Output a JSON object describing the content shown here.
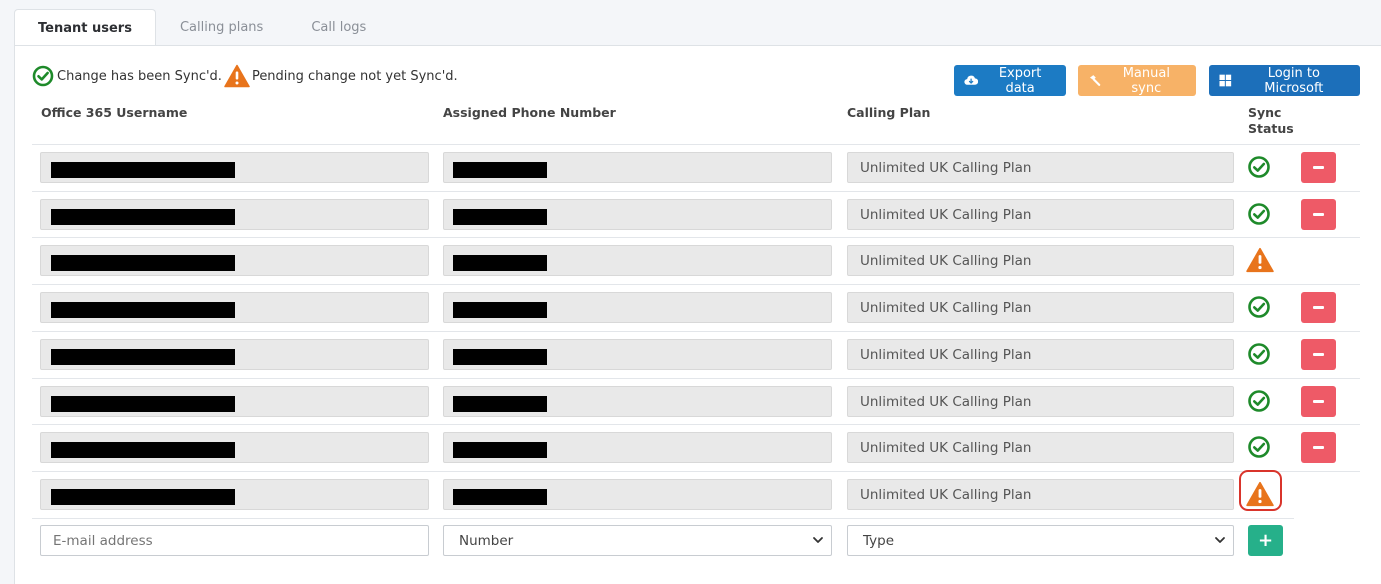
{
  "tabs": [
    {
      "label": "Tenant users",
      "active": true
    },
    {
      "label": "Calling plans",
      "active": false
    },
    {
      "label": "Call logs",
      "active": false
    }
  ],
  "legend": {
    "synced_text": "Change has been Sync'd.",
    "pending_text": "Pending change not yet Sync'd."
  },
  "toolbar": {
    "export_label": "Export data",
    "sync_label": "Manual sync",
    "login_label": "Login to Microsoft"
  },
  "columns": {
    "username": "Office 365 Username",
    "phone": "Assigned Phone Number",
    "plan": "Calling Plan",
    "status_line1": "Sync",
    "status_line2": "Status"
  },
  "rows": [
    {
      "plan": "Unlimited UK Calling Plan",
      "status": "synced",
      "deletable": true
    },
    {
      "plan": "Unlimited UK Calling Plan",
      "status": "synced",
      "deletable": true
    },
    {
      "plan": "Unlimited UK Calling Plan",
      "status": "pending",
      "deletable": false
    },
    {
      "plan": "Unlimited UK Calling Plan",
      "status": "synced",
      "deletable": true
    },
    {
      "plan": "Unlimited UK Calling Plan",
      "status": "synced",
      "deletable": true
    },
    {
      "plan": "Unlimited UK Calling Plan",
      "status": "synced",
      "deletable": true
    },
    {
      "plan": "Unlimited UK Calling Plan",
      "status": "synced",
      "deletable": true
    },
    {
      "plan": "Unlimited UK Calling Plan",
      "status": "pending",
      "deletable": false,
      "highlighted": true
    }
  ],
  "new_row": {
    "email_placeholder": "E-mail address",
    "number_value": "Number",
    "type_value": "Type",
    "add_label": "+"
  },
  "colors": {
    "ok": "#1e8a2a",
    "warn": "#e8741c",
    "delete": "#ee5a67",
    "add": "#26b08a",
    "export": "#1c7bc4",
    "sync": "#f7b267",
    "login": "#1c6fba",
    "highlight": "#d9342b"
  }
}
